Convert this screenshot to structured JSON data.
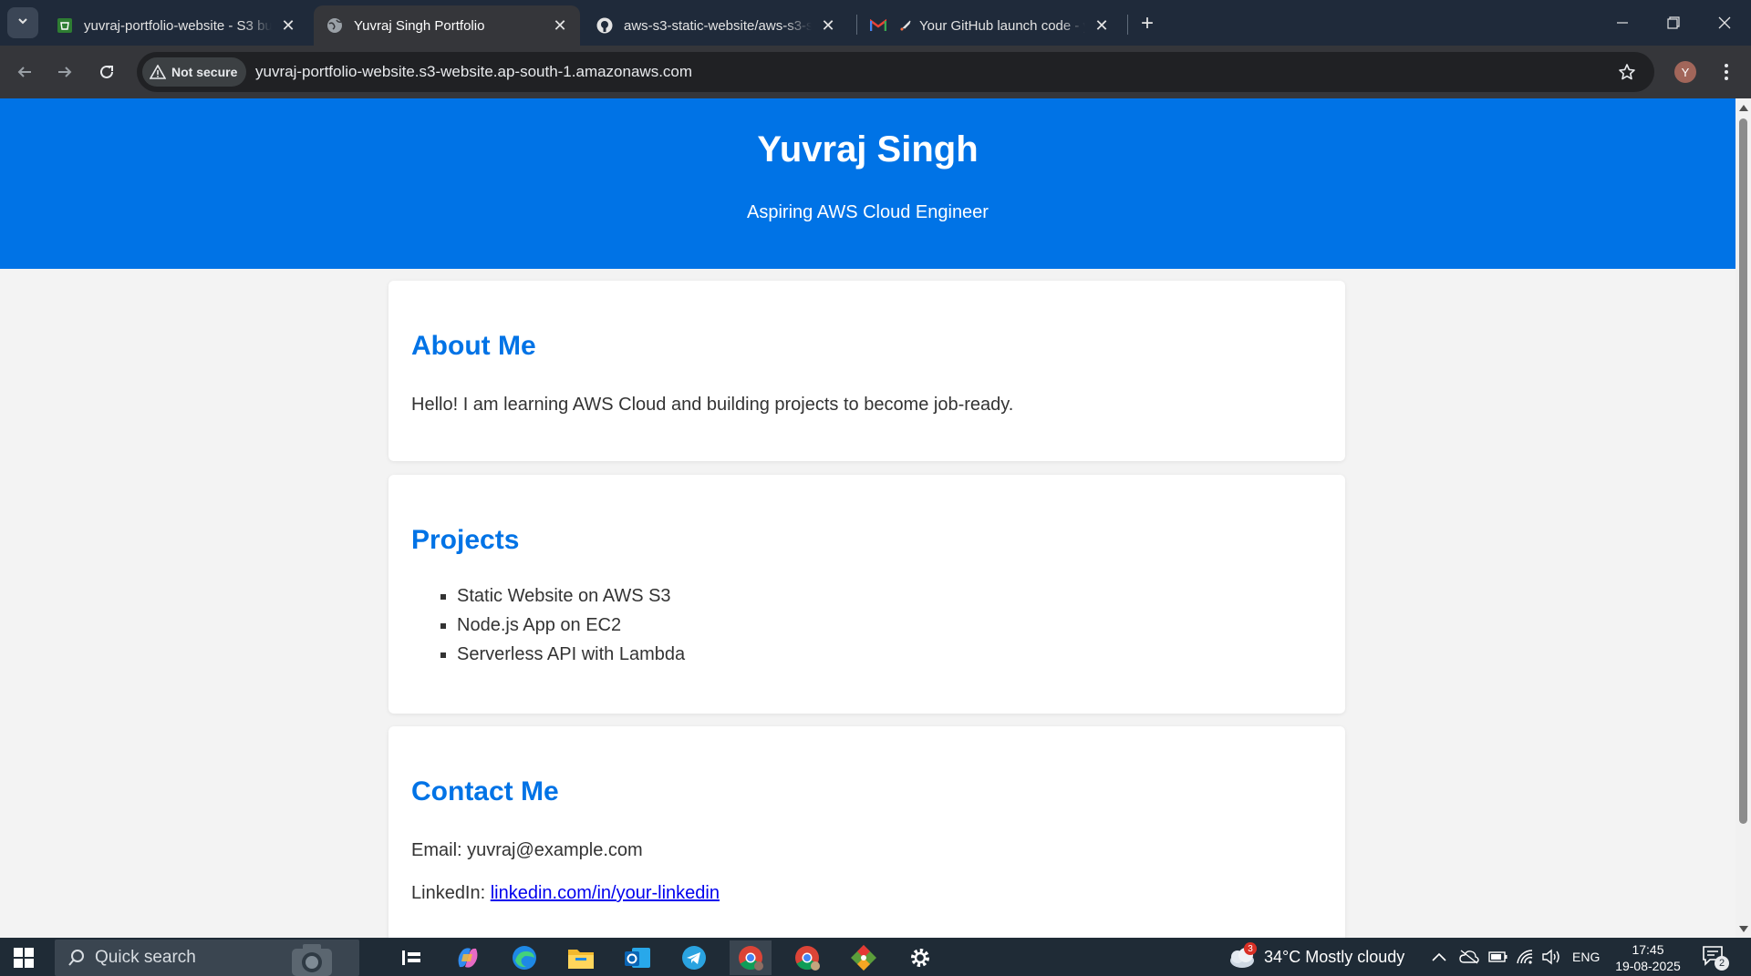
{
  "browser": {
    "tabs": [
      {
        "title": "yuvraj-portfolio-website - S3 bucket",
        "icon": "s3-bucket-icon",
        "active": false
      },
      {
        "title": "Yuvraj Singh Portfolio",
        "icon": "globe-icon",
        "active": true
      },
      {
        "title": "aws-s3-static-website/aws-s3-static",
        "icon": "github-icon",
        "active": false
      },
      {
        "title": "Your GitHub launch code - yuvraj",
        "icon": "gmail-icon",
        "active": false
      }
    ],
    "security_label": "Not secure",
    "url": "yuvraj-portfolio-website.s3-website.ap-south-1.amazonaws.com",
    "profile_initial": "Y"
  },
  "page": {
    "header": {
      "title": "Yuvraj Singh",
      "subtitle": "Aspiring AWS Cloud Engineer"
    },
    "about": {
      "heading": "About Me",
      "text": "Hello! I am learning AWS Cloud and building projects to become job-ready."
    },
    "projects": {
      "heading": "Projects",
      "items": [
        "Static Website on AWS S3",
        "Node.js App on EC2",
        "Serverless API with Lambda"
      ]
    },
    "contact": {
      "heading": "Contact Me",
      "email_label": "Email: ",
      "email": "yuvraj@example.com",
      "linkedin_label": "LinkedIn: ",
      "linkedin": "linkedin.com/in/your-linkedin"
    }
  },
  "taskbar": {
    "search_placeholder": "Quick search",
    "weather": "34°C  Mostly cloudy",
    "weather_badge": "3",
    "language": "ENG",
    "time": "17:45",
    "date": "19-08-2025",
    "notification_count": "2"
  },
  "colors": {
    "header_blue": "#0073e6",
    "heading_blue": "#0073e6",
    "link": "#0000ee"
  }
}
